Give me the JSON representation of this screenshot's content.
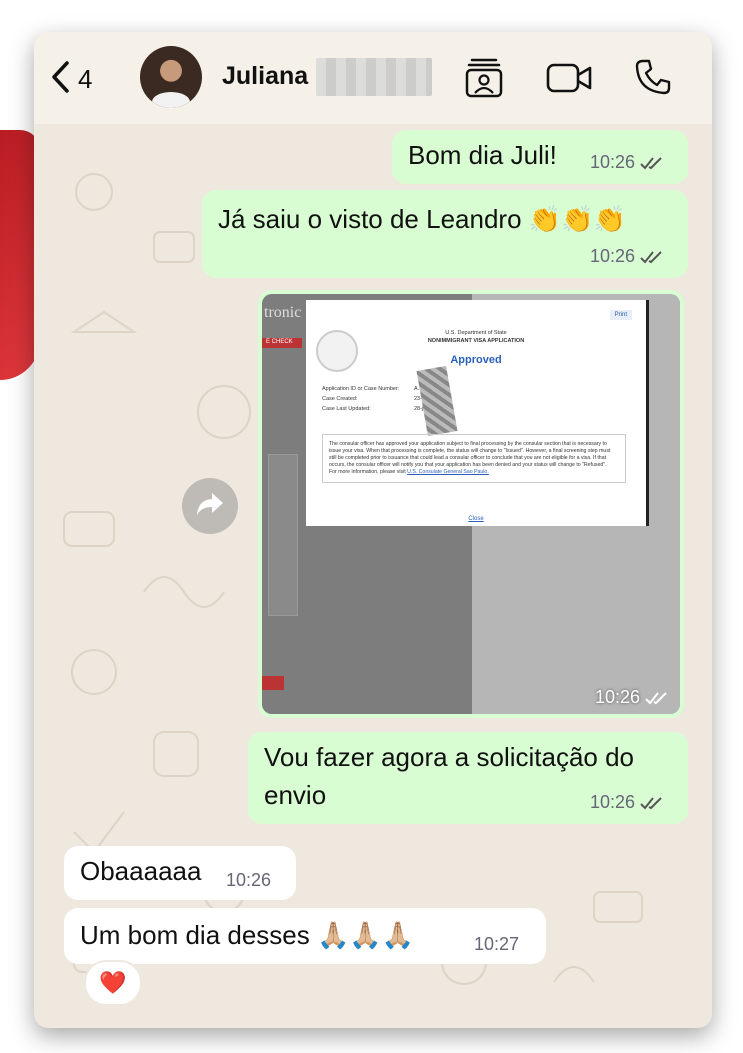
{
  "header": {
    "back_count": "4",
    "contact_name": "Juliana",
    "icons": [
      "back-chevron-icon",
      "contact-card-icon",
      "video-call-icon",
      "phone-call-icon"
    ]
  },
  "messages": [
    {
      "direction": "out",
      "text": "Bom dia Juli!",
      "time": "10:26",
      "status": "read"
    },
    {
      "direction": "out",
      "text": "Já saiu o visto de Leandro",
      "emoji": "👏👏👏",
      "time": "10:26",
      "status": "read"
    },
    {
      "direction": "out",
      "type": "image",
      "time": "10:26",
      "status": "read"
    },
    {
      "direction": "out",
      "text_line1": "Vou fazer agora a solicitação do",
      "text_line2": "envio",
      "time": "10:26",
      "status": "read"
    },
    {
      "direction": "in",
      "text": "Obaaaaaa",
      "time": "10:26"
    },
    {
      "direction": "in",
      "text": "Um bom dia desses",
      "emoji": "🙏🏼🙏🏼🙏🏼",
      "time": "10:27",
      "reaction": "❤️"
    }
  ],
  "screenshot": {
    "side_text": "tronic",
    "side_tag": "E CHECK",
    "print_label": "Print",
    "department": "U.S. Department of State",
    "form_title": "NONIMMIGRANT VISA APPLICATION",
    "status": "Approved",
    "fields": [
      {
        "label": "Application ID or Case Number:",
        "value": "A...03"
      },
      {
        "label": "Case Created:",
        "value": "23-..."
      },
      {
        "label": "Case Last Updated:",
        "value": "28-ja..."
      }
    ],
    "note": "The consular officer has approved your application subject to final processing by the consular section that is necessary to issue your visa. When that processing is complete, the status will change to \"Issued\". However, a final screening step must still be completed prior to issuance that could lead a consular officer to conclude that you are not eligible for a visa. If that occurs, the consular officer will notify you that your application has been denied and your status will change to \"Refused\".",
    "more_info": "For more information, please visit",
    "link": "U.S. Consulate General Sao Paulo.",
    "close_label": "Close"
  },
  "colors": {
    "outgoing_bubble": "#d9fdd3",
    "incoming_bubble": "#ffffff",
    "chat_background": "#efe8de",
    "accent_red": "#c8232a"
  }
}
